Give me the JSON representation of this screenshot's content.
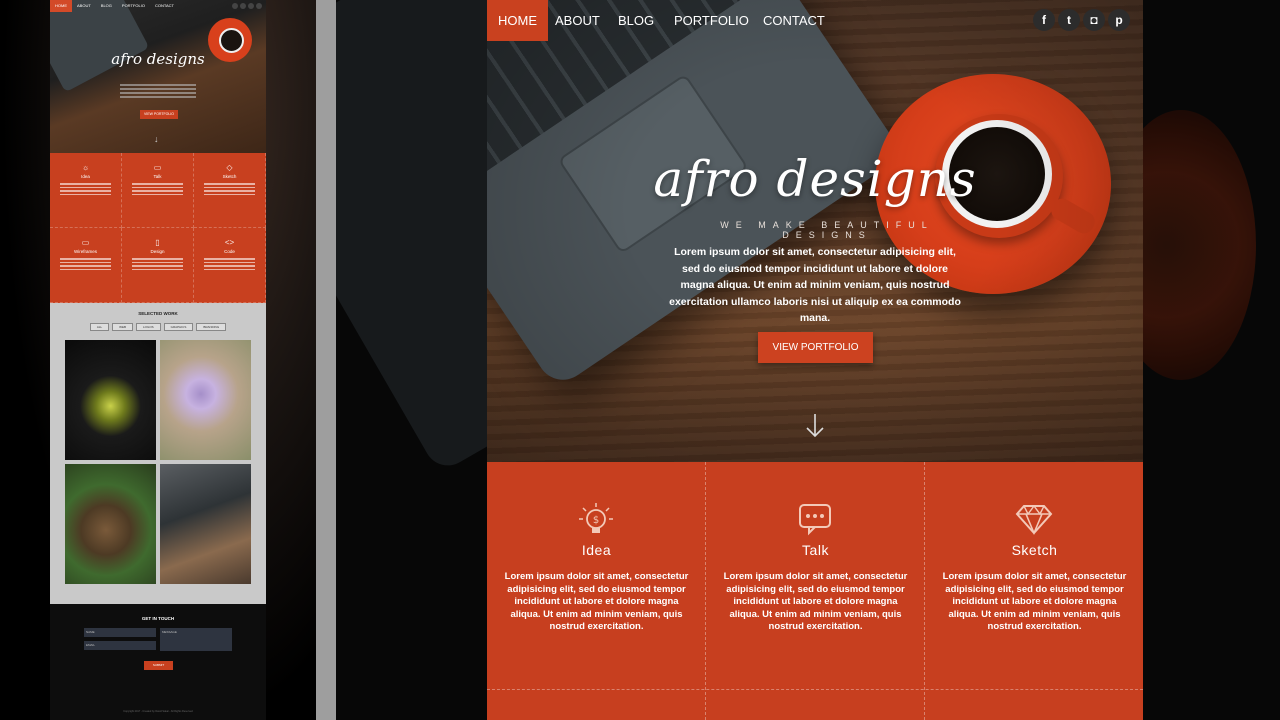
{
  "mini_preview": {
    "nav": [
      "HOME",
      "ABOUT",
      "BLOG",
      "PORTFOLIO",
      "CONTACT"
    ],
    "logo": "afro designs",
    "cta": "VIEW PORTFOLIO",
    "services": [
      "Idea",
      "Talk",
      "Sketch",
      "Wireframes",
      "Design",
      "Code"
    ],
    "work_heading": "SELECTED WORK",
    "filters": [
      "ALL",
      "WEB",
      "LOGOS",
      "GRAPHICS",
      "BRANDING"
    ],
    "contact_heading": "GET IN TOUCH",
    "fields": {
      "name": "NAME",
      "message": "MESSAGE",
      "email": "EMAIL"
    },
    "submit": "SUBMIT",
    "footer": "Copyright 2017 - Created by David Sakal - All Rights Reserved"
  },
  "nav": {
    "items": [
      "HOME",
      "ABOUT",
      "BLOG",
      "PORTFOLIO",
      "CONTACT"
    ],
    "active": "HOME",
    "social": [
      "facebook-icon",
      "twitter-icon",
      "instagram-icon",
      "pinterest-icon"
    ]
  },
  "hero": {
    "logo": "afro designs",
    "tagline": "WE MAKE BEAUTIFUL DESIGNS",
    "text": "Lorem ipsum dolor sit amet, consectetur adipisicing elit, sed do eiusmod tempor incididunt ut labore et dolore magna aliqua. Ut enim ad minim veniam, quis nostrud exercitation ullamco laboris nisi ut aliquip ex ea commodo mana.",
    "cta": "VIEW PORTFOLIO"
  },
  "services": [
    {
      "title": "Idea",
      "icon": "lightbulb-icon",
      "desc": "Lorem ipsum dolor sit amet, consectetur adipisicing elit, sed do eiusmod tempor incididunt ut labore et dolore magna aliqua. Ut enim ad minim veniam, quis nostrud exercitation."
    },
    {
      "title": "Talk",
      "icon": "chat-icon",
      "desc": "Lorem ipsum dolor sit amet, consectetur adipisicing elit, sed do eiusmod tempor incididunt ut labore et dolore magna aliqua. Ut enim ad minim veniam, quis nostrud exercitation."
    },
    {
      "title": "Sketch",
      "icon": "diamond-icon",
      "desc": "Lorem ipsum dolor sit amet, consectetur adipisicing elit, sed do eiusmod tempor incididunt ut labore et dolore magna aliqua. Ut enim ad minim veniam, quis nostrud exercitation."
    }
  ],
  "colors": {
    "accent": "#c9411f",
    "wood": "#5b3a26",
    "laptop": "#4b5358"
  }
}
